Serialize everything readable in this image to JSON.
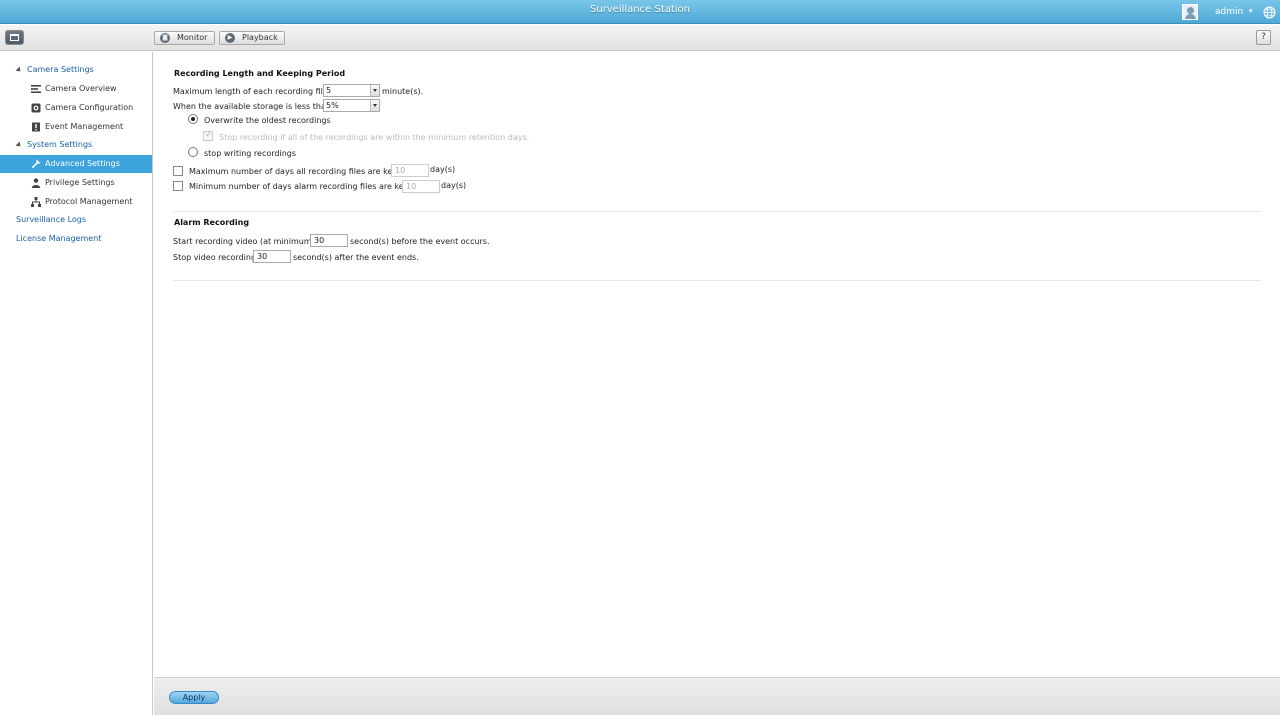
{
  "window": {
    "title": "Surveillance Station"
  },
  "user": {
    "name": "admin",
    "caret": "▾"
  },
  "toolbar": {
    "monitor_label": "Monitor",
    "playback_label": "Playback",
    "help_label": "?"
  },
  "sidebar": {
    "groups": [
      {
        "label": "Camera Settings",
        "items": [
          "Camera Overview",
          "Camera Configuration",
          "Event Management"
        ]
      },
      {
        "label": "System Settings",
        "items": [
          "Advanced Settings",
          "Privilege Settings",
          "Protocol Management"
        ]
      }
    ],
    "links": [
      "Surveillance Logs",
      "License Management"
    ],
    "active_item": "Advanced Settings"
  },
  "recording": {
    "section_title": "Recording Length and Keeping Period",
    "max_length_label": "Maximum length of each recording file:",
    "max_length_value": "5",
    "max_length_unit": "minute(s).",
    "storage_label": "When the available storage is less than",
    "storage_value": "5%",
    "overwrite_label": "Overwrite the oldest recordings",
    "stop_if_min_label": "Stop recording if all of the recordings are within the minimum retention days.",
    "stop_writing_label": "stop writing recordings",
    "max_days_label": "Maximum number of days all recording files are kept",
    "max_days_value": "10",
    "min_days_label": "Minimum number of days alarm recording files are kept",
    "min_days_value": "10",
    "days_unit": "day(s)"
  },
  "alarm": {
    "section_title": "Alarm Recording",
    "start_label": "Start recording video (at minimum)",
    "start_value": "30",
    "start_suffix": "second(s) before the event occurs.",
    "stop_label": "Stop video recording",
    "stop_value": "30",
    "stop_suffix": "second(s) after the event ends."
  },
  "footer": {
    "apply_label": "Apply"
  },
  "colors": {
    "accent": "#3da3dd",
    "titlebar": "#4fa9d6",
    "link": "#1a5fa8"
  }
}
